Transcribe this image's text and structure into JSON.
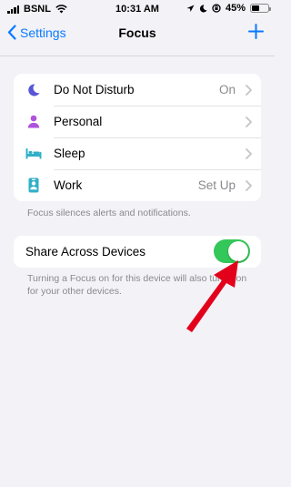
{
  "status_bar": {
    "carrier": "BSNL",
    "time": "10:31 AM",
    "battery": "45%",
    "battery_level": 0.45,
    "icons": [
      "signal-bars-icon",
      "wifi-icon",
      "location-icon",
      "moon-icon",
      "orientation-lock-icon",
      "battery-icon"
    ]
  },
  "nav": {
    "back_label": "Settings",
    "title": "Focus",
    "add_icon": "plus-icon"
  },
  "focus_list": {
    "items": [
      {
        "label": "Do Not Disturb",
        "value": "On",
        "icon": "moon-icon",
        "color": "#5856d6"
      },
      {
        "label": "Personal",
        "value": "",
        "icon": "person-icon",
        "color": "#af52de"
      },
      {
        "label": "Sleep",
        "value": "",
        "icon": "bed-icon",
        "color": "#30b0c7"
      },
      {
        "label": "Work",
        "value": "Set Up",
        "icon": "badge-icon",
        "color": "#30b0c7"
      }
    ],
    "footnote": "Focus silences alerts and notifications."
  },
  "share": {
    "label": "Share Across Devices",
    "enabled": true,
    "footnote": "Turning a Focus on for this device will also turn it on for your other devices."
  },
  "colors": {
    "accent": "#0a7aff",
    "toggle_on": "#34c759",
    "annotation_arrow": "#e3001b"
  }
}
